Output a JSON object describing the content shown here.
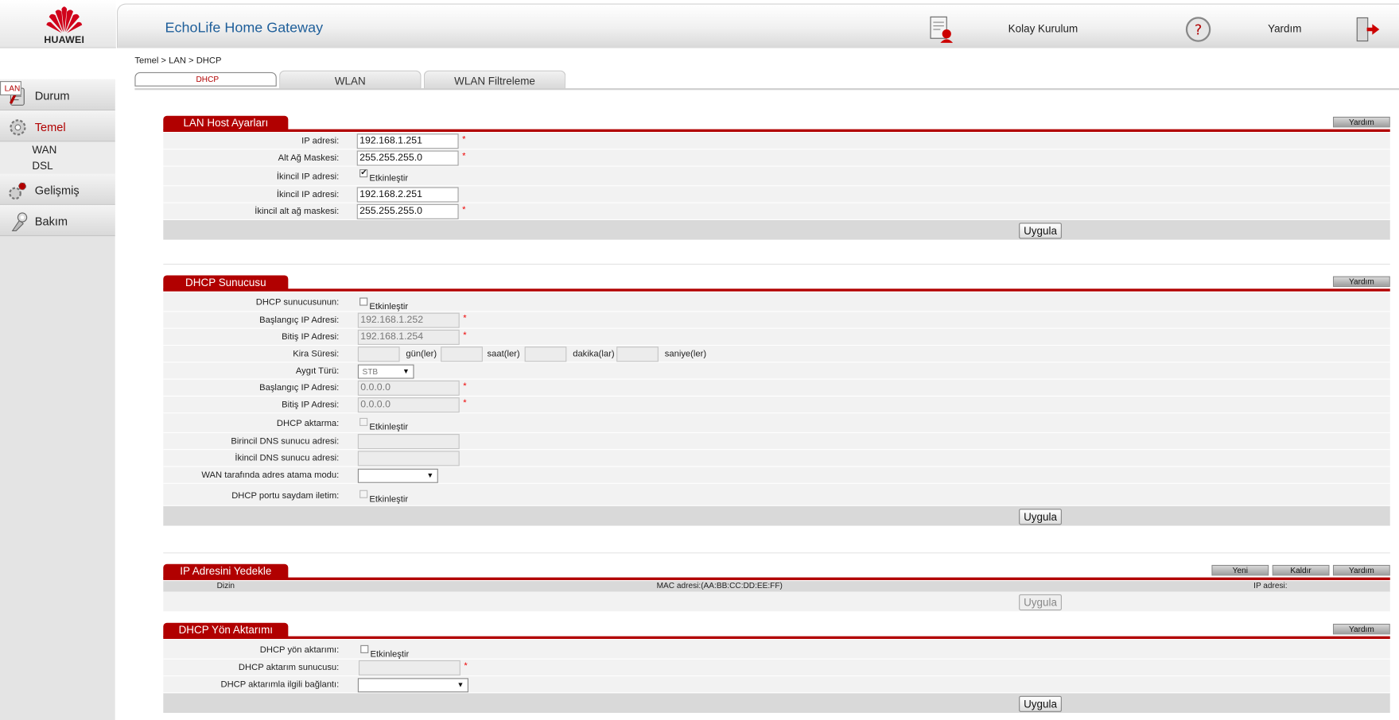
{
  "brand": {
    "logo_text": "HUAWEI"
  },
  "header": {
    "title": "EchoLife Home Gateway",
    "setup_label": "Kolay Kurulum",
    "help_label": "Yardım"
  },
  "sidebar": {
    "items": [
      {
        "label": "Durum"
      },
      {
        "label": "Temel",
        "subs": [
          "WAN",
          "LAN",
          "DSL"
        ]
      },
      {
        "label": "Gelişmiş"
      },
      {
        "label": "Bakım"
      }
    ]
  },
  "breadcrumb": "Temel > LAN > DHCP",
  "tabs": [
    "DHCP",
    "WLAN",
    "WLAN Filtreleme"
  ],
  "common": {
    "help_btn": "Yardım",
    "apply_btn": "Uygula",
    "enable_label": "Etkinleştir"
  },
  "lan_host": {
    "title": "LAN Host Ayarları",
    "rows": [
      {
        "label": "IP adresi:",
        "value": "192.168.1.251"
      },
      {
        "label": "Alt Ağ Maskesi:",
        "value": "255.255.255.0"
      },
      {
        "label": "İkincil IP adresi:"
      },
      {
        "label": "İkincil IP adresi:",
        "value": "192.168.2.251"
      },
      {
        "label": "İkincil alt ağ maskesi:",
        "value": "255.255.255.0"
      }
    ]
  },
  "dhcp_server": {
    "title": "DHCP Sunucusu",
    "rows": [
      {
        "label": "DHCP sunucusunun:"
      },
      {
        "label": "Başlangıç IP Adresi:",
        "value": "192.168.1.252"
      },
      {
        "label": "Bitiş IP Adresi:",
        "value": "192.168.1.254"
      },
      {
        "label": "Kira Süresi:"
      },
      {
        "label": "Aygıt Türü:",
        "value": "STB"
      },
      {
        "label": "Başlangıç IP Adresi:",
        "value": "0.0.0.0"
      },
      {
        "label": "Bitiş IP Adresi:",
        "value": "0.0.0.0"
      },
      {
        "label": "DHCP aktarma:"
      },
      {
        "label": "Birincil DNS sunucu adresi:"
      },
      {
        "label": "İkincil DNS sunucu adresi:"
      },
      {
        "label": "WAN tarafında adres atama modu:"
      },
      {
        "label": "DHCP portu saydam iletim:"
      }
    ],
    "lease_units": [
      "gün(ler)",
      "saat(ler)",
      "dakika(lar)",
      "saniye(ler)"
    ]
  },
  "ip_backup": {
    "title": "IP Adresini Yedekle",
    "buttons": [
      "Yeni",
      "Kaldır",
      "Yardım"
    ],
    "columns": [
      "Dizin",
      "MAC adresi:(AA:BB:CC:DD:EE:FF)",
      "IP adresi:"
    ]
  },
  "dhcp_relay": {
    "title": "DHCP Yön Aktarımı",
    "rows": [
      {
        "label": "DHCP yön aktarımı:"
      },
      {
        "label": "DHCP aktarım sunucusu:"
      },
      {
        "label": "DHCP aktarımla ilgili bağlantı:"
      }
    ]
  }
}
